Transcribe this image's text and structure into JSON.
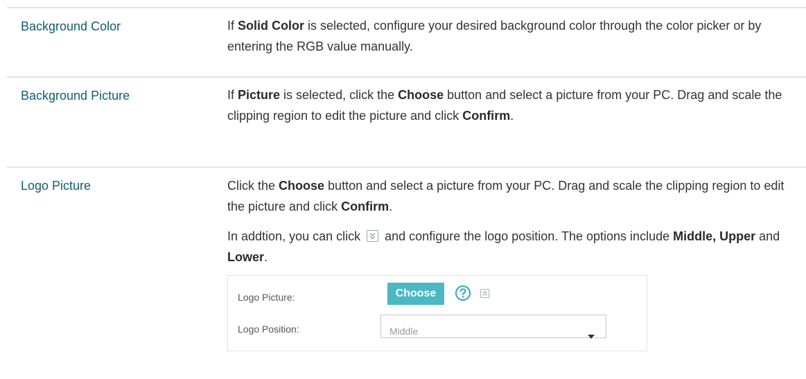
{
  "rows": [
    {
      "term": "Background Color",
      "desc": [
        {
          "t": "If "
        },
        {
          "t": "Solid Color",
          "b": true
        },
        {
          "t": " is selected, configure your desired background color through the color picker or by entering the RGB value manually."
        }
      ]
    },
    {
      "term": "Background Picture",
      "desc": [
        {
          "t": "If "
        },
        {
          "t": "Picture",
          "b": true
        },
        {
          "t": " is selected, click the "
        },
        {
          "t": "Choose",
          "b": true
        },
        {
          "t": " button and select a picture from your PC. Drag and scale the clipping region to edit the picture and click "
        },
        {
          "t": "Confirm",
          "b": true
        },
        {
          "t": "."
        }
      ]
    },
    {
      "term": "Logo Picture",
      "p1": [
        {
          "t": "Click the "
        },
        {
          "t": "Choose",
          "b": true
        },
        {
          "t": " button and select a picture from your PC. Drag and scale the clipping region to edit the picture and click "
        },
        {
          "t": "Confirm",
          "b": true
        },
        {
          "t": "."
        }
      ],
      "p2_before": "In addtion, you can click",
      "p2_after": [
        {
          "t": " and configure the logo position. The options include "
        },
        {
          "t": "Middle, Upper",
          "b": true
        },
        {
          "t": " and "
        },
        {
          "t": "Lower",
          "b": true
        },
        {
          "t": "."
        }
      ]
    }
  ],
  "panel": {
    "logo_picture_label": "Logo Picture:",
    "choose_button": "Choose",
    "logo_position_label": "Logo Position:",
    "logo_position_value": "Middle"
  },
  "colors": {
    "term": "#0f5d73",
    "accent": "#4bb8c4",
    "divider": "#dfe4e7"
  },
  "icons": [
    "expand-down-icon",
    "help-icon",
    "collapse-up-icon",
    "dropdown-arrow-icon"
  ]
}
